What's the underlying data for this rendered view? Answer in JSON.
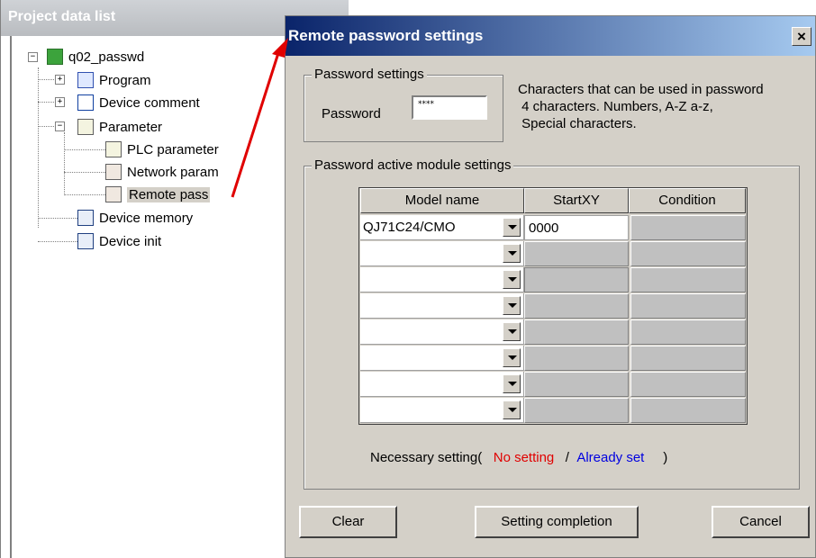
{
  "project_panel": {
    "title": "Project data list",
    "tree": [
      {
        "label": "q02_passwd",
        "icon": "project-icon",
        "expander": "−"
      },
      {
        "label": "Program",
        "icon": "program-icon",
        "expander": "+"
      },
      {
        "label": "Device comment",
        "icon": "device-comment-icon",
        "expander": "+"
      },
      {
        "label": "Parameter",
        "icon": "parameter-icon",
        "expander": "−"
      },
      {
        "label": "PLC parameter",
        "icon": "plc-parameter-icon"
      },
      {
        "label": "Network param",
        "icon": "network-param-icon"
      },
      {
        "label": "Remote pass",
        "icon": "remote-pass-icon",
        "selected": true
      },
      {
        "label": "Device memory",
        "icon": "device-memory-icon"
      },
      {
        "label": "Device init",
        "icon": "device-init-icon"
      }
    ]
  },
  "dialog": {
    "title": "Remote password settings",
    "close_label": "×",
    "password_group": {
      "legend": "Password settings",
      "label": "Password",
      "value": "****",
      "help_lines": [
        "Characters that can be used in password",
        " 4 characters. Numbers, A-Z a-z,",
        " Special characters."
      ]
    },
    "module_group": {
      "legend": "Password active module settings",
      "columns": [
        "Model name",
        "StartXY",
        "Condition"
      ],
      "rows": [
        {
          "model": "QJ71C24/CMO",
          "startxy": "0000",
          "condition": ""
        },
        {
          "model": "",
          "startxy": "",
          "condition": ""
        },
        {
          "model": "",
          "startxy": "",
          "condition": ""
        },
        {
          "model": "",
          "startxy": "",
          "condition": ""
        },
        {
          "model": "",
          "startxy": "",
          "condition": ""
        },
        {
          "model": "",
          "startxy": "",
          "condition": ""
        },
        {
          "model": "",
          "startxy": "",
          "condition": ""
        },
        {
          "model": "",
          "startxy": "",
          "condition": ""
        }
      ],
      "legend_note": {
        "prefix": "Necessary setting(",
        "no_setting": "No setting",
        "separator": "/",
        "already_set": "Already set",
        "suffix": ")"
      }
    },
    "buttons": {
      "clear": "Clear",
      "complete": "Setting completion",
      "cancel": "Cancel"
    }
  },
  "colors": {
    "titlebar_start": "#0a246a",
    "titlebar_end": "#a6caf0",
    "dialog_face": "#d4d0c8",
    "no_setting": "#e00000",
    "already_set": "#0000e0",
    "arrow": "#e00000"
  }
}
